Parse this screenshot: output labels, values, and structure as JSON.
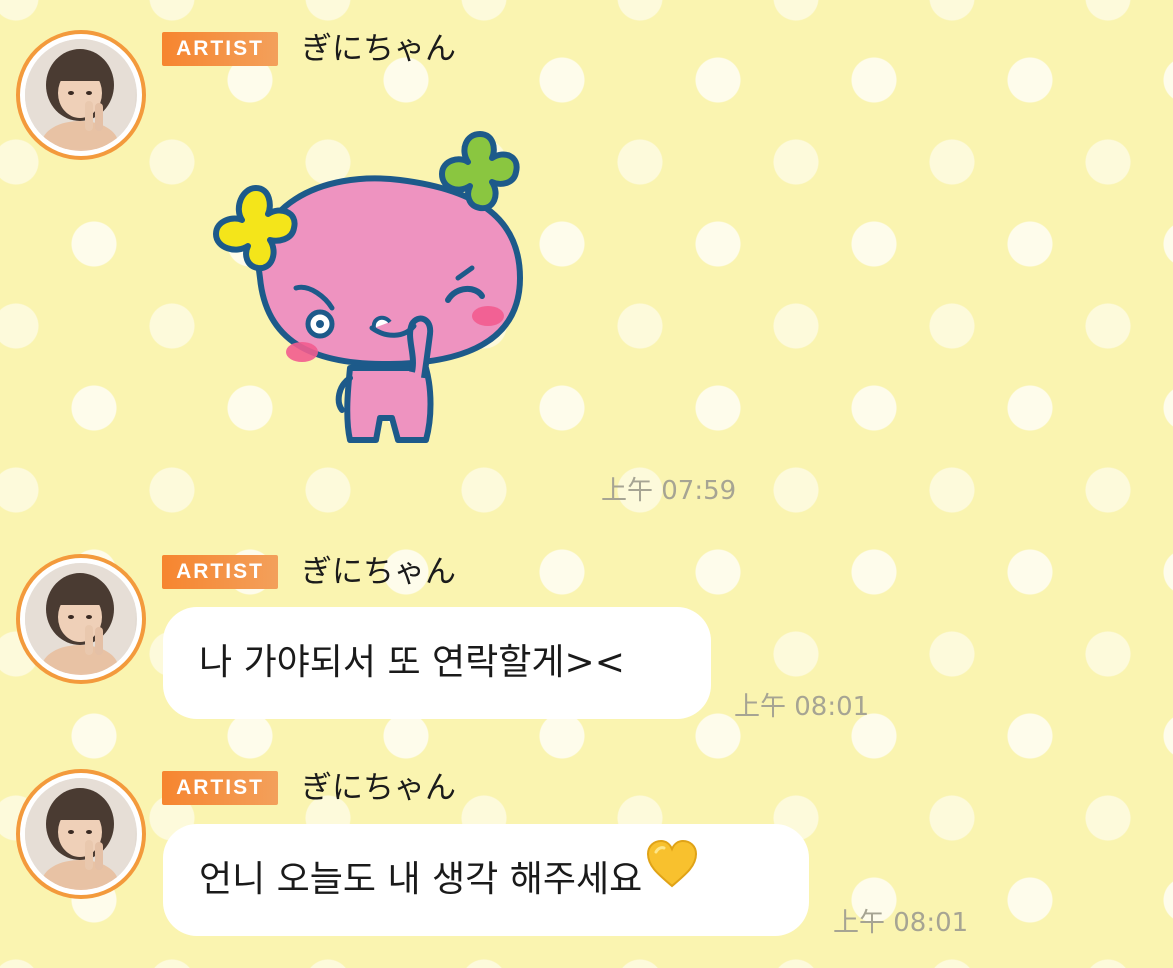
{
  "messages": [
    {
      "badge": "ARTIST",
      "sender": "ぎにちゃん",
      "type": "sticker",
      "sticker": "pink-character-sticker",
      "time": "上午 07:59"
    },
    {
      "badge": "ARTIST",
      "sender": "ぎにちゃん",
      "type": "text",
      "text": "나 가야되서 또 연락할게><",
      "time": "上午 08:01"
    },
    {
      "badge": "ARTIST",
      "sender": "ぎにちゃん",
      "type": "text",
      "text": "언니 오늘도 내 생각 해주세요",
      "emoji": "yellow-heart",
      "time": "上午 08:01"
    }
  ],
  "colors": {
    "background": "#faf4b0",
    "badge": "#f6852f",
    "avatar_ring": "#f39a3c",
    "bubble": "#ffffff",
    "time": "#a6a493"
  }
}
